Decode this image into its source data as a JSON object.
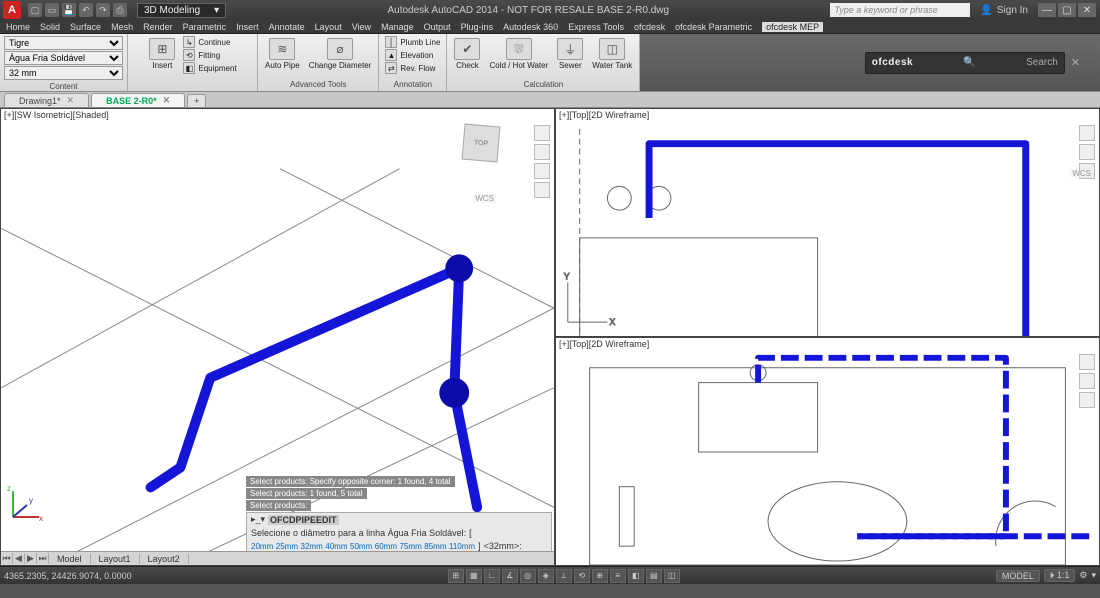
{
  "title": "Autodesk AutoCAD 2014 - NOT FOR RESALE    BASE 2-R0.dwg",
  "workspace": "3D Modeling",
  "search_placeholder": "Type a keyword or phrase",
  "signin_label": "Sign In",
  "menus": [
    "Home",
    "Solid",
    "Surface",
    "Mesh",
    "Render",
    "Parametric",
    "Insert",
    "Annotate",
    "Layout",
    "View",
    "Manage",
    "Output",
    "Plug-ins",
    "Autodesk 360",
    "Express Tools",
    "ofcdesk",
    "ofcdesk Parametric",
    "ofcdesk MEP"
  ],
  "active_menu": "ofcdesk MEP",
  "ribbon": {
    "left": {
      "combo1": "Tigre",
      "combo2": "Água Fria Soldável",
      "combo3": "32 mm",
      "panel": "Content"
    },
    "panels": [
      {
        "title": "",
        "big": [
          {
            "label": "Insert"
          }
        ],
        "small": [
          {
            "label": "Continue"
          },
          {
            "label": "Fitting"
          },
          {
            "label": "Equipment"
          }
        ]
      },
      {
        "title": "Advanced Tools",
        "big": [
          {
            "label": "Auto Pipe"
          },
          {
            "label": "Change Diameter"
          }
        ]
      },
      {
        "title": "Annotation",
        "small": [
          {
            "label": "Plumb Line"
          },
          {
            "label": "Elevation"
          },
          {
            "label": "Rev. Flow"
          }
        ]
      },
      {
        "title": "Calculation",
        "big": [
          {
            "label": "Check"
          },
          {
            "label": "Cold / Hot Water"
          },
          {
            "label": "Sewer"
          },
          {
            "label": "Water Tank"
          }
        ]
      }
    ],
    "ofc_brand": "ofcdesk",
    "ofc_search": "Search"
  },
  "doc_tabs": [
    {
      "label": "Drawing1*",
      "active": false
    },
    {
      "label": "BASE 2-R0*",
      "active": true
    }
  ],
  "viewports": {
    "left": "[+][SW Isometric][Shaded]",
    "tr": "[+][Top][2D Wireframe]",
    "br": "[+][Top][2D Wireframe]",
    "wcs": "WCS"
  },
  "command": {
    "history": [
      "Select products: Specify opposite corner: 1 found, 4 total",
      "Select products: 1 found, 5 total",
      "Select products:"
    ],
    "prompt_cmd": "OFCDPIPEEDIT",
    "prompt_text": "Selecione o diâmetro para a linha Água Fria Soldável:",
    "options": [
      "20mm",
      "25mm",
      "32mm",
      "40mm",
      "50mm",
      "60mm",
      "75mm",
      "85mm",
      "110mm"
    ],
    "current": "<32mm>:"
  },
  "layout_tabs": [
    "Model",
    "Layout1",
    "Layout2"
  ],
  "status": {
    "coords": "4365.2305, 24426.9074, 0.0000",
    "model": "MODEL",
    "scale": "1:1"
  }
}
